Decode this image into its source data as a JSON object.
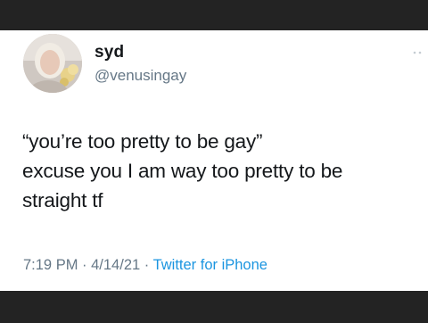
{
  "tweet": {
    "display_name": "syd",
    "handle": "@venusingay",
    "lines": [
      "“you’re too pretty to be gay”",
      "excuse you I am way too pretty to be",
      "straight tf"
    ],
    "time": "7:19 PM",
    "separator": " · ",
    "date": "4/14/21",
    "source": "Twitter for iPhone"
  },
  "colors": {
    "frame": "#232323",
    "card": "#ffffff",
    "text": "#14171a",
    "muted": "#657786",
    "link": "#1b95e0"
  },
  "icons": {
    "avatar": "profile-photo",
    "more": "more-icon"
  }
}
